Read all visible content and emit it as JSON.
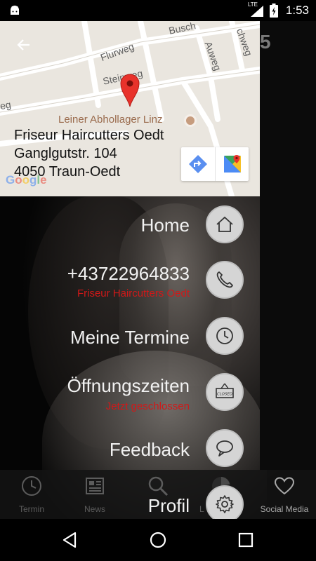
{
  "status_bar": {
    "network": "LTE",
    "time": "1:53",
    "icons": [
      "android-icon",
      "lte-signal-icon",
      "battery-charging-icon"
    ]
  },
  "map": {
    "street_labels": [
      "Flurweg",
      "Busch",
      "Auweg",
      "chweg",
      "Steinweg",
      "eg"
    ],
    "poi_name": "Leiner Abhollager Linz",
    "address": {
      "line1": "Friseur Haircutters Oedt",
      "line2": "Ganglgutstr. 104",
      "line3": "4050 Traun-Oedt"
    },
    "watermark": "Google",
    "overlay_glyph": "5"
  },
  "menu": {
    "items": [
      {
        "label": "Home",
        "icon": "home-icon"
      },
      {
        "label": "+43722964833",
        "sub": "Friseur Haircutters Oedt",
        "icon": "phone-icon"
      },
      {
        "label": "Meine Termine",
        "icon": "clock-icon"
      },
      {
        "label": "Öffnungszeiten",
        "sub": "Jetzt geschlossen",
        "icon": "closed-sign-icon",
        "icon_text": "CLOSED"
      },
      {
        "label": "Feedback",
        "icon": "speech-bubble-icon"
      },
      {
        "label": "Profil",
        "icon": "gear-icon"
      }
    ]
  },
  "tabbar": {
    "tabs": [
      {
        "label": "Termin",
        "icon": "clock-icon"
      },
      {
        "label": "News",
        "icon": "newspaper-icon"
      },
      {
        "label": "",
        "icon": "search-icon"
      },
      {
        "label": "L",
        "icon": "pie-icon"
      },
      {
        "label": "Social Media",
        "icon": "heart-icon"
      }
    ]
  },
  "colors": {
    "accent_red": "#d11818",
    "menu_text": "#f2f2f2",
    "circle_bg": "#d5d5d5",
    "map_bg": "#eae6df"
  }
}
